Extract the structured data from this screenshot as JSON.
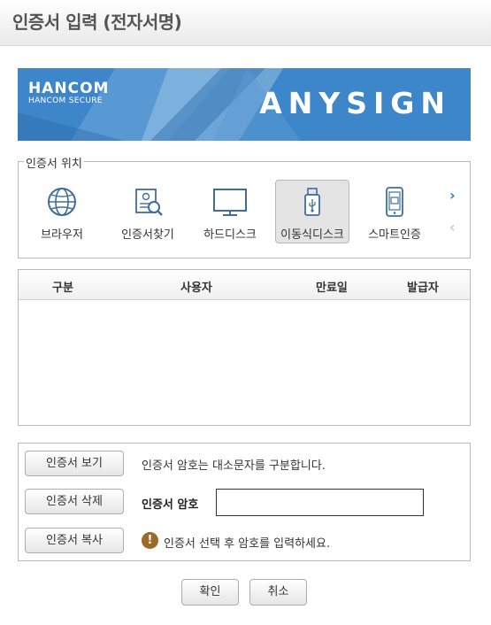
{
  "window": {
    "title": "인증서 입력 (전자서명)"
  },
  "banner": {
    "logo_text": "HANCOM",
    "logo_sub": "HANCOM SECURE",
    "product": "ANYSIGN",
    "color": "#3d86c9"
  },
  "location": {
    "legend": "인증서 위치",
    "items": [
      {
        "label": "브라우저",
        "icon": "globe-icon"
      },
      {
        "label": "인증서찾기",
        "icon": "certificate-search-icon"
      },
      {
        "label": "하드디스크",
        "icon": "monitor-icon"
      },
      {
        "label": "이동식디스크",
        "icon": "usb-drive-icon",
        "selected": true
      },
      {
        "label": "스마트인증",
        "icon": "smartphone-icon"
      }
    ],
    "next_icon": "chevron-right-icon",
    "prev_icon": "chevron-left-icon"
  },
  "table": {
    "columns": [
      "구분",
      "사용자",
      "만료일",
      "발급자"
    ],
    "rows": []
  },
  "actions": {
    "view_label": "인증서 보기",
    "delete_label": "인증서 삭제",
    "copy_label": "인증서 복사",
    "case_notice": "인증서 암호는 대소문자를 구분합니다.",
    "password_label": "인증서 암호",
    "password_value": "",
    "hint": "인증서 선택 후 암호를 입력하세요.",
    "hint_icon": "warning-icon"
  },
  "footer": {
    "ok_label": "확인",
    "cancel_label": "취소"
  }
}
